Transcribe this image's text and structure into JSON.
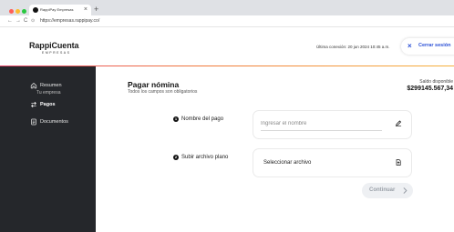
{
  "browser": {
    "tab_title": "RappiPay Empresas",
    "tab_close": "×",
    "new_tab": "+",
    "back": "←",
    "forward": "→",
    "reload": "C",
    "url_icon": "⊙",
    "url": "https://empresas.rappipay.co/"
  },
  "header": {
    "brand_name": "RappiCuenta",
    "brand_sub": "EMPRESAS",
    "last_connection": "Última conexión: 20 jun 2024 10:45 a.m.",
    "logout_icon": "×",
    "logout_label": "Cerrar sesión",
    "accent_gradient": [
      "#e6446a",
      "#f07a3a",
      "#f5b13d"
    ]
  },
  "sidebar": {
    "items": [
      {
        "label": "Resumen",
        "sublabel": "Tu empresa",
        "icon": "home-icon",
        "active": false
      },
      {
        "label": "Pagos",
        "icon": "transfer-arrows-icon",
        "active": true
      },
      {
        "label": "Documentos",
        "icon": "document-icon",
        "active": false
      }
    ]
  },
  "main": {
    "title": "Pagar nómina",
    "subtitle": "Todos los campos son obligatorios",
    "balance_label": "Saldo disponible",
    "balance_value": "$299145.567,34",
    "steps": [
      {
        "number": "1",
        "label": "Nombre del pago",
        "placeholder": "Ingresar el nombre",
        "value": "",
        "icon": "pencil-icon"
      },
      {
        "number": "2",
        "label": "Subir archivo plano",
        "file_label": "Seleccionar archivo",
        "icon": "file-upload-icon"
      }
    ],
    "continue_label": "Continuar",
    "continue_icon": "chevron-right-icon"
  },
  "colors": {
    "sidebar_bg": "#25272b",
    "link_blue": "#2b50d6",
    "disabled_text": "#9aa0a8"
  }
}
